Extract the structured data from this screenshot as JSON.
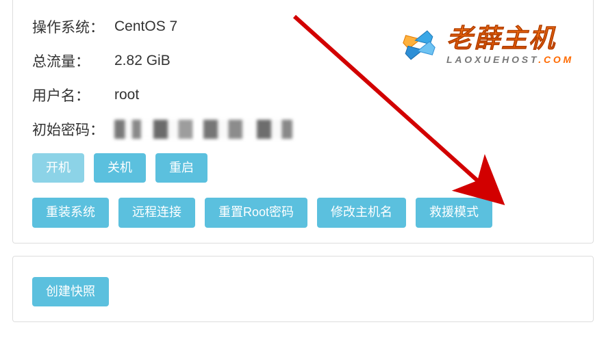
{
  "info": {
    "os_label": "操作系统：",
    "os_value": "CentOS 7",
    "traffic_label": "总流量：",
    "traffic_value": "2.82 GiB",
    "user_label": "用户名：",
    "user_value": "root",
    "password_label": "初始密码："
  },
  "power_buttons": {
    "start": "开机",
    "stop": "关机",
    "restart": "重启"
  },
  "action_buttons": {
    "reinstall": "重装系统",
    "remote": "远程连接",
    "reset_root": "重置Root密码",
    "change_hostname": "修改主机名",
    "rescue": "救援模式"
  },
  "snapshot": {
    "create": "创建快照"
  },
  "branding": {
    "cn": "老薛主机",
    "en_prefix": "LAOXUEHOST",
    "en_dot": ".",
    "en_suffix": "COM"
  }
}
